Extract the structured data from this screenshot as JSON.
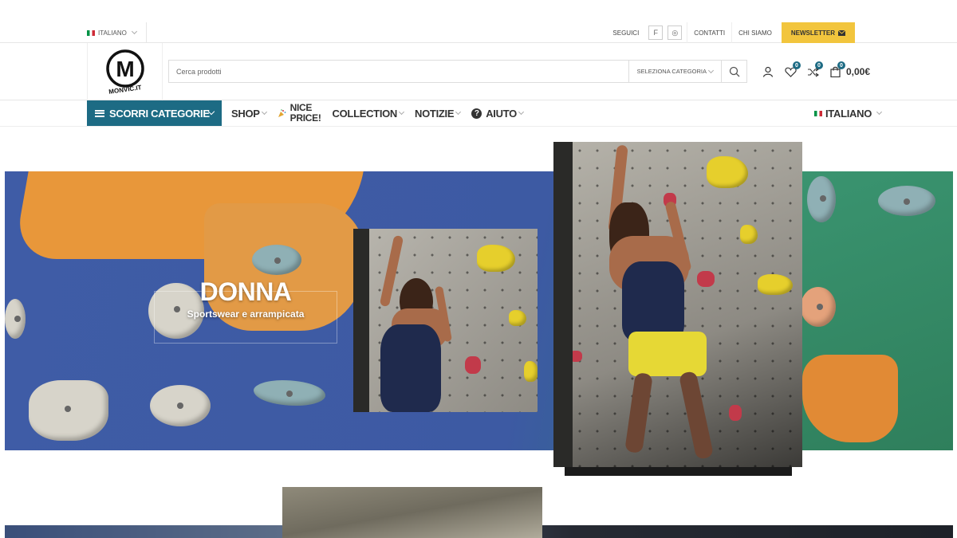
{
  "topbar": {
    "language": "ITALIANO",
    "follow_label": "SEGUICI",
    "social": [
      {
        "icon": "facebook-icon",
        "glyph": "f"
      },
      {
        "icon": "instagram-icon",
        "glyph": "◎"
      }
    ],
    "links": [
      "CONTATTI",
      "CHI SIAMO"
    ],
    "newsletter_label": "NEWSLETTER",
    "newsletter_icon": "envelope-icon"
  },
  "header": {
    "logo_text": "MONVIC.IT",
    "logo_letter": "M",
    "search": {
      "placeholder": "Cerca prodotti",
      "category_label": "SELEZIONA CATEGORIA"
    },
    "wishlist_count": "0",
    "compare_count": "0",
    "cart_count": "0",
    "cart_total": "0,00€"
  },
  "nav": {
    "categories_label": "SCORRI CATEGORIE",
    "items": [
      "SHOP",
      "NICE\nPRICE!",
      "COLLECTION",
      "NOTIZIE",
      "AIUTO"
    ],
    "language": "ITALIANO",
    "accent": "#1d6b84"
  },
  "hero": {
    "title": "DONNA",
    "subtitle": "Sportswear e arrampicata"
  },
  "colors": {
    "accent": "#1d6b84",
    "newsletter": "#f2c53d"
  }
}
